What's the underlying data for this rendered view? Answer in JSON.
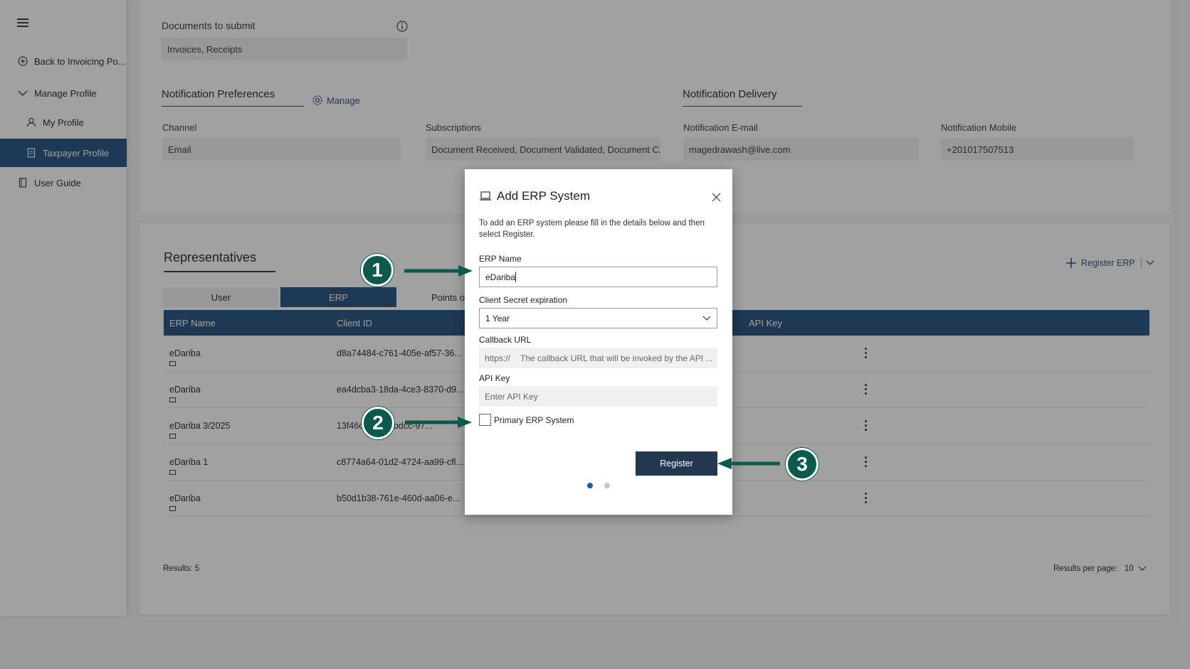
{
  "sidebar": {
    "items": [
      {
        "label": "Back to Invoicing Po..."
      },
      {
        "label": "Manage Profile"
      },
      {
        "label": "My Profile"
      },
      {
        "label": "Taxpayer Profile"
      },
      {
        "label": "User Guide"
      }
    ]
  },
  "top": {
    "documents_label": "Documents to submit",
    "documents_value": "Invoices, Receipts",
    "notification_prefs_title": "Notification Preferences",
    "manage_link": "Manage",
    "notification_delivery_title": "Notification Delivery",
    "channel_label": "Channel",
    "channel_value": "Email",
    "subscriptions_label": "Subscriptions",
    "subscriptions_value": "Document Received, Document Validated, Document C...",
    "email_label": "Notification E-mail",
    "email_value": "magedrawash@live.com",
    "mobile_label": "Notification Mobile",
    "mobile_value": "+201017507513"
  },
  "representatives": {
    "title": "Representatives",
    "register_erp": "Register ERP",
    "tabs": [
      "User",
      "ERP",
      "Points of"
    ],
    "columns": [
      "ERP Name",
      "Client ID",
      "API Key"
    ],
    "rows": [
      {
        "name": "eDariba",
        "client_id": "d8a74484-c761-405e-af57-36..."
      },
      {
        "name": "eDariba",
        "client_id": "ea4dcba3-18da-4ce3-8370-d9..."
      },
      {
        "name": "eDariba 3/2025",
        "client_id": "13f46c...4489-bdcc-97..."
      },
      {
        "name": "eDariba 1",
        "client_id": "c8774a64-01d2-4724-aa99-cfl..."
      },
      {
        "name": "eDariba",
        "client_id": "b50d1b38-761e-460d-aa06-e..."
      }
    ],
    "results": "Results: 5",
    "results_per_page_label": "Results per page:",
    "results_per_page_value": "10"
  },
  "modal": {
    "title": "Add ERP System",
    "description": "To add an ERP system please fill in the details below and then select Register.",
    "erp_name_label": "ERP Name",
    "erp_name_value": "eDariba",
    "secret_label": "Client Secret expiration",
    "secret_value": "1 Year",
    "callback_label": "Callback URL",
    "callback_prefix": "https://",
    "callback_placeholder": "The callback URL that will be invoked by the API ...",
    "api_key_label": "API Key",
    "api_key_placeholder": "Enter API Key",
    "primary_label": "Primary ERP System",
    "register_button": "Register"
  },
  "annotations": [
    "1",
    "2",
    "3"
  ],
  "colors": {
    "primary": "#1c4d7a",
    "button": "#22384f",
    "badge": "#0c5a4e",
    "dot_active": "#1c5fae"
  }
}
